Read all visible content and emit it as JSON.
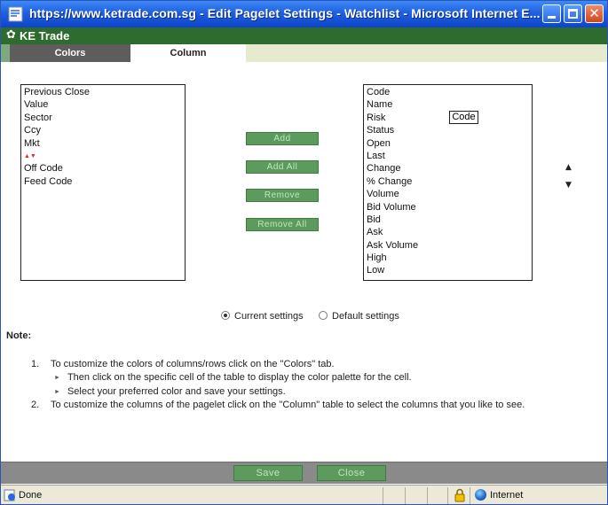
{
  "window": {
    "title": "https://www.ketrade.com.sg - Edit Pagelet Settings - Watchlist - Microsoft Internet E...",
    "icons": {
      "app": "ie-icon",
      "minimize": "minimize-icon",
      "maximize": "maximize-icon",
      "close": "close-icon"
    }
  },
  "app": {
    "title": "KE Trade",
    "icon": "gear-icon"
  },
  "tabs": [
    {
      "label": "Colors",
      "active": false
    },
    {
      "label": "Column",
      "active": true
    }
  ],
  "available_columns": [
    "Previous Close",
    "Value",
    "Sector",
    "Ccy",
    "Mkt",
    "▲▼",
    "Off Code",
    "Feed Code"
  ],
  "selected_columns": [
    "Code",
    "Name",
    "Risk",
    "Status",
    "Open",
    "Last",
    "Change",
    "% Change",
    "Volume",
    "Bid Volume",
    "Bid",
    "Ask",
    "Ask Volume",
    "High",
    "Low"
  ],
  "tooltip": "Code",
  "buttons": {
    "add": "Add",
    "add_all": "Add All",
    "remove": "Remove",
    "remove_all": "Remove All"
  },
  "order_arrows": {
    "up": "▲",
    "down": "▼"
  },
  "settings": {
    "current": "Current settings",
    "default": "Default settings",
    "selected": "current"
  },
  "note": {
    "title": "Note:",
    "items": [
      {
        "num": "1.",
        "text": "To customize the colors of columns/rows click on the \"Colors\" tab."
      },
      {
        "bullet": "►",
        "text": "Then click on the specific cell of the table to display the color palette for the cell."
      },
      {
        "bullet": "►",
        "text": "Select your preferred color and save your settings."
      },
      {
        "num": "2.",
        "text": "To customize the columns of the pagelet click on the \"Column\" table to select the columns that you like to see."
      }
    ]
  },
  "footer": {
    "save": "Save",
    "close": "Close"
  },
  "status": {
    "text": "Done",
    "zone": "Internet"
  },
  "colors": {
    "titlebar": "#1f5fe0",
    "appbar": "#2e6b2e",
    "button": "#5d9a5d",
    "button_text": "#bfe6bf"
  }
}
